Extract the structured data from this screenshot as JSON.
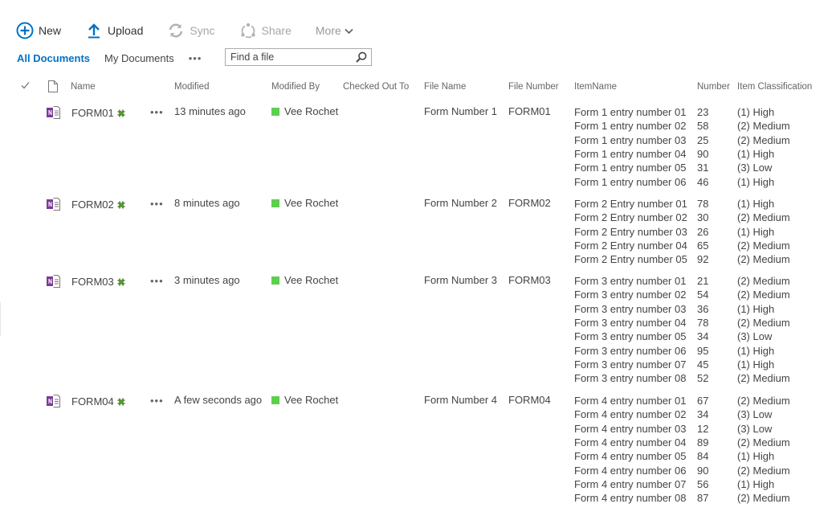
{
  "commands": {
    "new": "New",
    "upload": "Upload",
    "sync": "Sync",
    "share": "Share",
    "more": "More"
  },
  "views": {
    "all_documents": "All Documents",
    "my_documents": "My Documents",
    "more": "•••"
  },
  "search": {
    "placeholder": "Find a file",
    "value": ""
  },
  "columns": {
    "name": "Name",
    "modified": "Modified",
    "modified_by": "Modified By",
    "checked_out_to": "Checked Out To",
    "file_name": "File Name",
    "file_number": "File Number",
    "item_name": "ItemName",
    "number": "Number",
    "item_classification": "Item Classification"
  },
  "colors": {
    "accent": "#0072c6",
    "presence": "#5dcf4f",
    "onenote": "#7b3a96",
    "new_badge": "#4c8a2b"
  },
  "rows": [
    {
      "name": "FORM01",
      "ellipsis": "•••",
      "modified": "13 minutes ago",
      "modified_by": "Vee Rochet",
      "checked_out_to": "",
      "file_name": "Form Number 1",
      "file_number": "FORM01",
      "items": [
        {
          "name": "Form 1 entry number 01",
          "number": "23",
          "classification": "(1) High"
        },
        {
          "name": "Form 1 entry number 02",
          "number": "58",
          "classification": "(2) Medium"
        },
        {
          "name": "Form 1 entry number 03",
          "number": "25",
          "classification": "(2) Medium"
        },
        {
          "name": "Form 1 entry number 04",
          "number": "90",
          "classification": "(1) High"
        },
        {
          "name": "Form 1 entry number 05",
          "number": "31",
          "classification": "(3) Low"
        },
        {
          "name": "Form 1 entry number 06",
          "number": "46",
          "classification": "(1) High"
        }
      ]
    },
    {
      "name": "FORM02",
      "ellipsis": "•••",
      "modified": "8 minutes ago",
      "modified_by": "Vee Rochet",
      "checked_out_to": "",
      "file_name": "Form Number 2",
      "file_number": "FORM02",
      "items": [
        {
          "name": "Form 2 Entry number 01",
          "number": "78",
          "classification": "(1) High"
        },
        {
          "name": "Form 2 Entry number 02",
          "number": "30",
          "classification": "(2) Medium"
        },
        {
          "name": "Form 2 Entry number 03",
          "number": "26",
          "classification": "(1) High"
        },
        {
          "name": "Form 2 Entry number 04",
          "number": "65",
          "classification": "(2) Medium"
        },
        {
          "name": "Form 2 Entry number 05",
          "number": "92",
          "classification": "(2) Medium"
        }
      ]
    },
    {
      "name": "FORM03",
      "ellipsis": "•••",
      "modified": "3 minutes ago",
      "modified_by": "Vee Rochet",
      "checked_out_to": "",
      "file_name": "Form Number 3",
      "file_number": "FORM03",
      "items": [
        {
          "name": "Form 3 entry number 01",
          "number": "21",
          "classification": "(2) Medium"
        },
        {
          "name": "Form 3 entry number 02",
          "number": "54",
          "classification": "(2) Medium"
        },
        {
          "name": "Form 3 entry number 03",
          "number": "36",
          "classification": "(1) High"
        },
        {
          "name": "Form 3 entry number 04",
          "number": "78",
          "classification": "(2) Medium"
        },
        {
          "name": "Form 3 entry number 05",
          "number": "34",
          "classification": "(3) Low"
        },
        {
          "name": "Form 3 entry number 06",
          "number": "95",
          "classification": "(1) High"
        },
        {
          "name": "Form 3 entry number 07",
          "number": "45",
          "classification": "(1) High"
        },
        {
          "name": "Form 3 entry number 08",
          "number": "52",
          "classification": "(2) Medium"
        }
      ]
    },
    {
      "name": "FORM04",
      "ellipsis": "•••",
      "modified": "A few seconds ago",
      "modified_by": "Vee Rochet",
      "checked_out_to": "",
      "file_name": "Form Number 4",
      "file_number": "FORM04",
      "items": [
        {
          "name": "Form 4 entry number 01",
          "number": "67",
          "classification": "(2) Medium"
        },
        {
          "name": "Form 4 entry number 02",
          "number": "34",
          "classification": "(3) Low"
        },
        {
          "name": "Form 4 entry number 03",
          "number": "12",
          "classification": "(3) Low"
        },
        {
          "name": "Form 4 entry number 04",
          "number": "89",
          "classification": "(2) Medium"
        },
        {
          "name": "Form 4 entry number 05",
          "number": "84",
          "classification": "(1) High"
        },
        {
          "name": "Form 4 entry number 06",
          "number": "90",
          "classification": "(2) Medium"
        },
        {
          "name": "Form 4 entry number 07",
          "number": "56",
          "classification": "(1) High"
        },
        {
          "name": "Form 4 entry number 08",
          "number": "87",
          "classification": "(2) Medium"
        }
      ]
    }
  ]
}
